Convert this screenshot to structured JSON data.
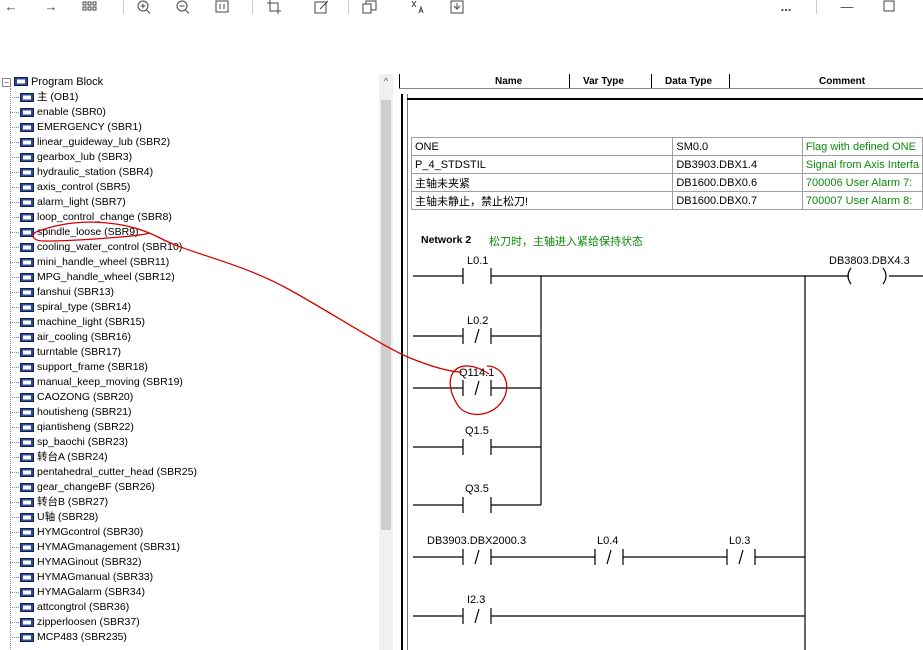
{
  "toolbar": {
    "icons": [
      "back-arrow-icon",
      "forward-arrow-icon",
      "grid-view-icon",
      "zoom-in-icon",
      "zoom-out-icon",
      "page-view-icon",
      "crop-icon",
      "edit-icon",
      "copy-image-icon",
      "translate-icon",
      "save-icon",
      "more-icon",
      "minimize-icon",
      "maximize-icon"
    ],
    "more_label": "...",
    "back_glyph": "←",
    "forward_glyph": "→",
    "minimize_glyph": "—"
  },
  "tree": {
    "root_label": "Program Block",
    "items": [
      "主 (OB1)",
      "enable (SBR0)",
      "EMERGENCY (SBR1)",
      "linear_guideway_lub (SBR2)",
      "gearbox_lub (SBR3)",
      "hydraulic_station (SBR4)",
      "axis_control (SBR5)",
      "alarm_light (SBR7)",
      "loop_control_change (SBR8)",
      "spindle_loose (SBR9)",
      "cooling_water_control (SBR10)",
      "mini_handle_wheel (SBR11)",
      "MPG_handle_wheel (SBR12)",
      "fanshui (SBR13)",
      "spiral_type (SBR14)",
      "machine_light (SBR15)",
      "air_cooling (SBR16)",
      "turntable (SBR17)",
      "support_frame (SBR18)",
      "manual_keep_moving (SBR19)",
      "CAOZONG (SBR20)",
      "houtisheng (SBR21)",
      "qiantisheng (SBR22)",
      "sp_baochi (SBR23)",
      "转台A (SBR24)",
      "pentahedral_cutter_head (SBR25)",
      "gear_changeBF (SBR26)",
      "转台B (SBR27)",
      "U轴 (SBR28)",
      "HYMGcontrol (SBR30)",
      "HYMAGmanagement (SBR31)",
      "HYMAGinout (SBR32)",
      "HYMAGmanual (SBR33)",
      "HYMAGalarm (SBR34)",
      "attcongtrol (SBR36)",
      "zipperloosen (SBR37)",
      "MCP483 (SBR235)"
    ]
  },
  "editor": {
    "columns": [
      "Name",
      "Var Type",
      "Data Type",
      "Comment"
    ],
    "symbols": [
      {
        "name": "ONE",
        "address": "SM0.0",
        "comment": "Flag with defined ONE"
      },
      {
        "name": "P_4_STDSTIL",
        "address": "DB3903.DBX1.4",
        "comment": "Signal from Axis Interfa"
      },
      {
        "name": "主轴未夹紧",
        "address": "DB1600.DBX0.6",
        "comment": "700006 User Alarm 7:"
      },
      {
        "name": "主轴未静止，禁止松刀!",
        "address": "DB1600.DBX0.7",
        "comment": "700007 User Alarm 8:"
      }
    ],
    "network": {
      "label": "Network 2",
      "comment": "松刀时，主轴进入紧给保持状态",
      "contacts": {
        "c1": "L0.1",
        "c2": "L0.2",
        "c3": "Q114.1",
        "c4": "Q1.5",
        "c5": "Q3.5",
        "c6": "DB3903.DBX2000.3",
        "c7": "L0.4",
        "c8": "L0.3",
        "c9": "I2.3"
      },
      "coil": "DB3803.DBX4.3"
    }
  },
  "annotation_color": "#d40000"
}
